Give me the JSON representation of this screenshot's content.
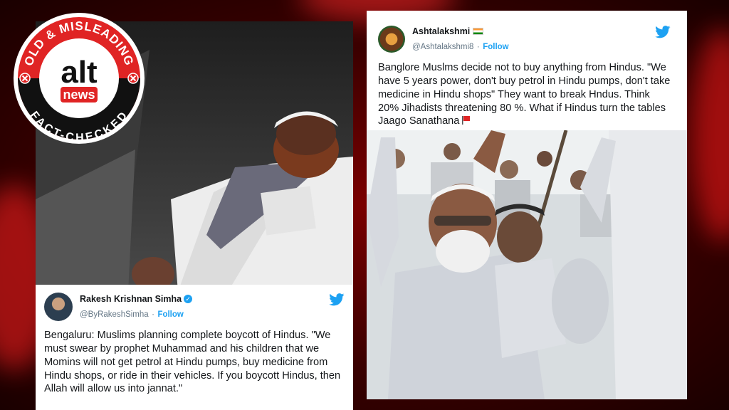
{
  "badge": {
    "top_text": "OLD & MISLEADING",
    "logo_main": "alt",
    "logo_sub": "news",
    "bottom_text": "FACT-CHECKED",
    "colors": {
      "red": "#e02424",
      "black": "#111111",
      "white": "#ffffff"
    }
  },
  "tweet_left": {
    "name": "Rakesh Krishnan Simha",
    "handle": "@ByRakeshSimha",
    "separator": "·",
    "follow": "Follow",
    "text": "Bengaluru: Muslims planning complete boycott of Hindus. \"We must swear by prophet Muhammad and his children that we Momins will not get petrol at Hindu pumps, buy medicine from Hindu shops, or ride in their vehicles. If you boycott Hindus, then Allah will allow us into jannat.\"",
    "icons": [
      "verified-icon",
      "twitter-bird-icon"
    ]
  },
  "tweet_right": {
    "name": "Ashtalakshmi",
    "handle": "@Ashtalakshmi8",
    "separator": "·",
    "follow": "Follow",
    "text": "Banglore Muslms decide not to buy anything from Hindus. \"We have 5 years power, don't buy petrol in Hindu pumps, don't take medicine in Hindu shops\"  They want to break Hndus. Think  20% Jihadists threatening 80 %.  What if Hindus  turn the tables  Jaago Sanathana",
    "icons": [
      "india-flag-icon",
      "red-flag-icon",
      "twitter-bird-icon"
    ]
  },
  "colors": {
    "twitter_blue": "#1da1f2",
    "background_red": "#7a0000"
  }
}
